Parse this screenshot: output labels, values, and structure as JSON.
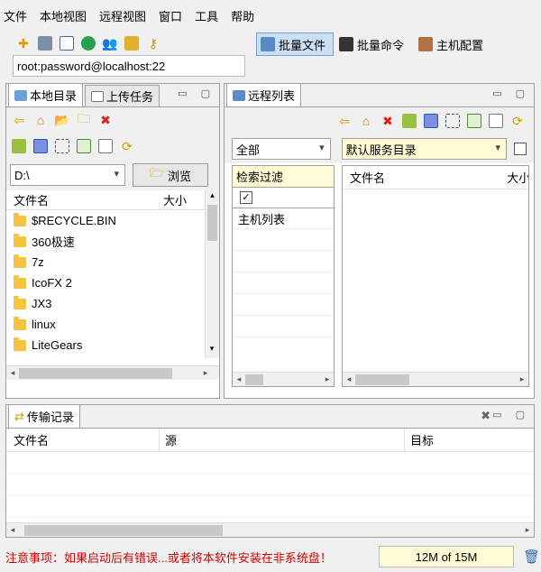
{
  "menu": [
    "文件",
    "本地视图",
    "远程视图",
    "窗口",
    "工具",
    "帮助"
  ],
  "toolbar": {
    "connection": "root:password@localhost:22",
    "batch_file": "批量文件",
    "batch_command": "批量命令",
    "host_config": "主机配置"
  },
  "local": {
    "tab_local": "本地目录",
    "tab_upload": "上传任务",
    "drive": "D:\\",
    "browse": "浏览",
    "col_name": "文件名",
    "col_size": "大小",
    "files": [
      "$RECYCLE.BIN",
      "360极速",
      "7z",
      "IcoFX 2",
      "JX3",
      "linux",
      "LiteGears"
    ]
  },
  "remote": {
    "tab": "远程列表",
    "filter_all": "全部",
    "default_dir": "默认服务目录",
    "search_filter": "检索过滤",
    "host_list": "主机列表",
    "col_name": "文件名",
    "col_size": "大小"
  },
  "transfer": {
    "tab": "传输记录",
    "col_name": "文件名",
    "col_source": "源",
    "col_target": "目标"
  },
  "status": {
    "notice": "注意事项：如果启动后有错误...或者将本软件安装在非系统盘！",
    "memory": "12M of 15M"
  },
  "colors": {
    "notice": "#d40000",
    "selection": "#cce0f5",
    "folder": "#f5c542"
  }
}
